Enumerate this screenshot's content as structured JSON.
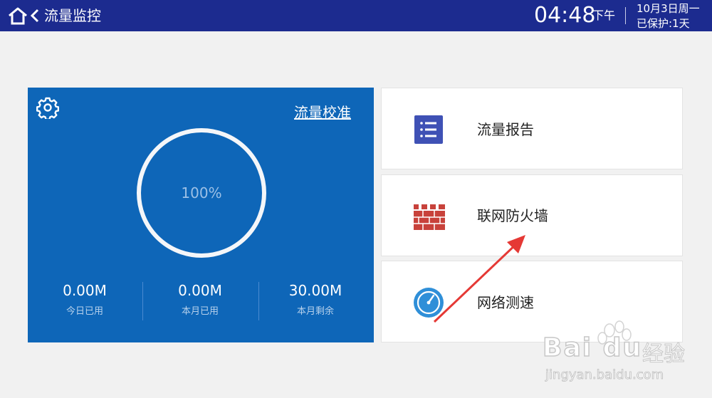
{
  "topbar": {
    "title": "流量监控",
    "time": "04:48",
    "ampm": "下午",
    "date": "10月3日周一",
    "protect": "已保护:1天"
  },
  "main_card": {
    "calibrate_label": "流量校准",
    "percent": "100%",
    "stats": [
      {
        "value": "0.00M",
        "label": "今日已用"
      },
      {
        "value": "0.00M",
        "label": "本月已用"
      },
      {
        "value": "30.00M",
        "label": "本月剩余"
      }
    ]
  },
  "tiles": [
    {
      "label": "流量报告",
      "icon": "report-list-icon"
    },
    {
      "label": "联网防火墙",
      "icon": "firewall-brick-icon"
    },
    {
      "label": "网络测速",
      "icon": "speedometer-icon"
    }
  ],
  "watermark": {
    "brand": "Bai du",
    "brand_cn": "经验",
    "url": "jingyan.baidu.com"
  },
  "colors": {
    "topbar": "#1c2b8f",
    "card": "#0e66b8",
    "report_icon": "#3f51b5",
    "firewall_icon": "#c8423b",
    "speed_icon": "#2f8fd8",
    "arrow": "#e53935"
  }
}
